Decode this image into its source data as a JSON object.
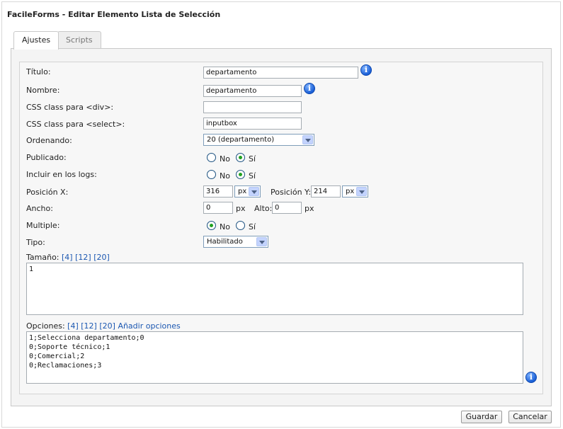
{
  "window": {
    "title": "FacileForms - Editar Elemento Lista de Selección"
  },
  "tabs": [
    {
      "label": "Ajustes",
      "active": true
    },
    {
      "label": "Scripts",
      "active": false
    }
  ],
  "form": {
    "titulo": {
      "label": "Título:",
      "value": "departamento"
    },
    "nombre": {
      "label": "Nombre:",
      "value": "departamento"
    },
    "css_div": {
      "label": "CSS class para <div>:",
      "value": ""
    },
    "css_select": {
      "label": "CSS class para <select>:",
      "value": "inputbox"
    },
    "ordenando": {
      "label": "Ordenando:",
      "value": "20 (departamento)"
    },
    "publicado": {
      "label": "Publicado:",
      "no": "No",
      "si": "Sí",
      "selected": "Sí"
    },
    "logs": {
      "label": "Incluir en los logs:",
      "no": "No",
      "si": "Sí",
      "selected": "Sí"
    },
    "posx": {
      "label": "Posición X:",
      "value": "316",
      "unit": "px"
    },
    "posy": {
      "label": "Posición Y:",
      "value": "214",
      "unit": "px"
    },
    "ancho": {
      "label": "Ancho:",
      "value": "0",
      "unit": "px"
    },
    "alto": {
      "label": "Alto:",
      "value": "0",
      "unit": "px"
    },
    "multiple": {
      "label": "Multiple:",
      "no": "No",
      "si": "Sí",
      "selected": "No"
    },
    "tipo": {
      "label": "Tipo:",
      "value": "Habilitado"
    },
    "tamano": {
      "label": "Tamaño:",
      "links": [
        "[4]",
        "[12]",
        "[20]"
      ],
      "value": "1"
    },
    "opciones": {
      "label": "Opciones:",
      "links": [
        "[4]",
        "[12]",
        "[20]",
        "Añadir opciones"
      ],
      "lines": [
        "1;Selecciona departamento;0",
        "0;Soporte técnico;1",
        "0;Comercial;2",
        "0;Reclamaciones;3"
      ]
    }
  },
  "buttons": {
    "save": "Guardar",
    "cancel": "Cancelar"
  },
  "icons": {
    "info": "info-icon",
    "dropdown": "chevron-down-icon"
  }
}
